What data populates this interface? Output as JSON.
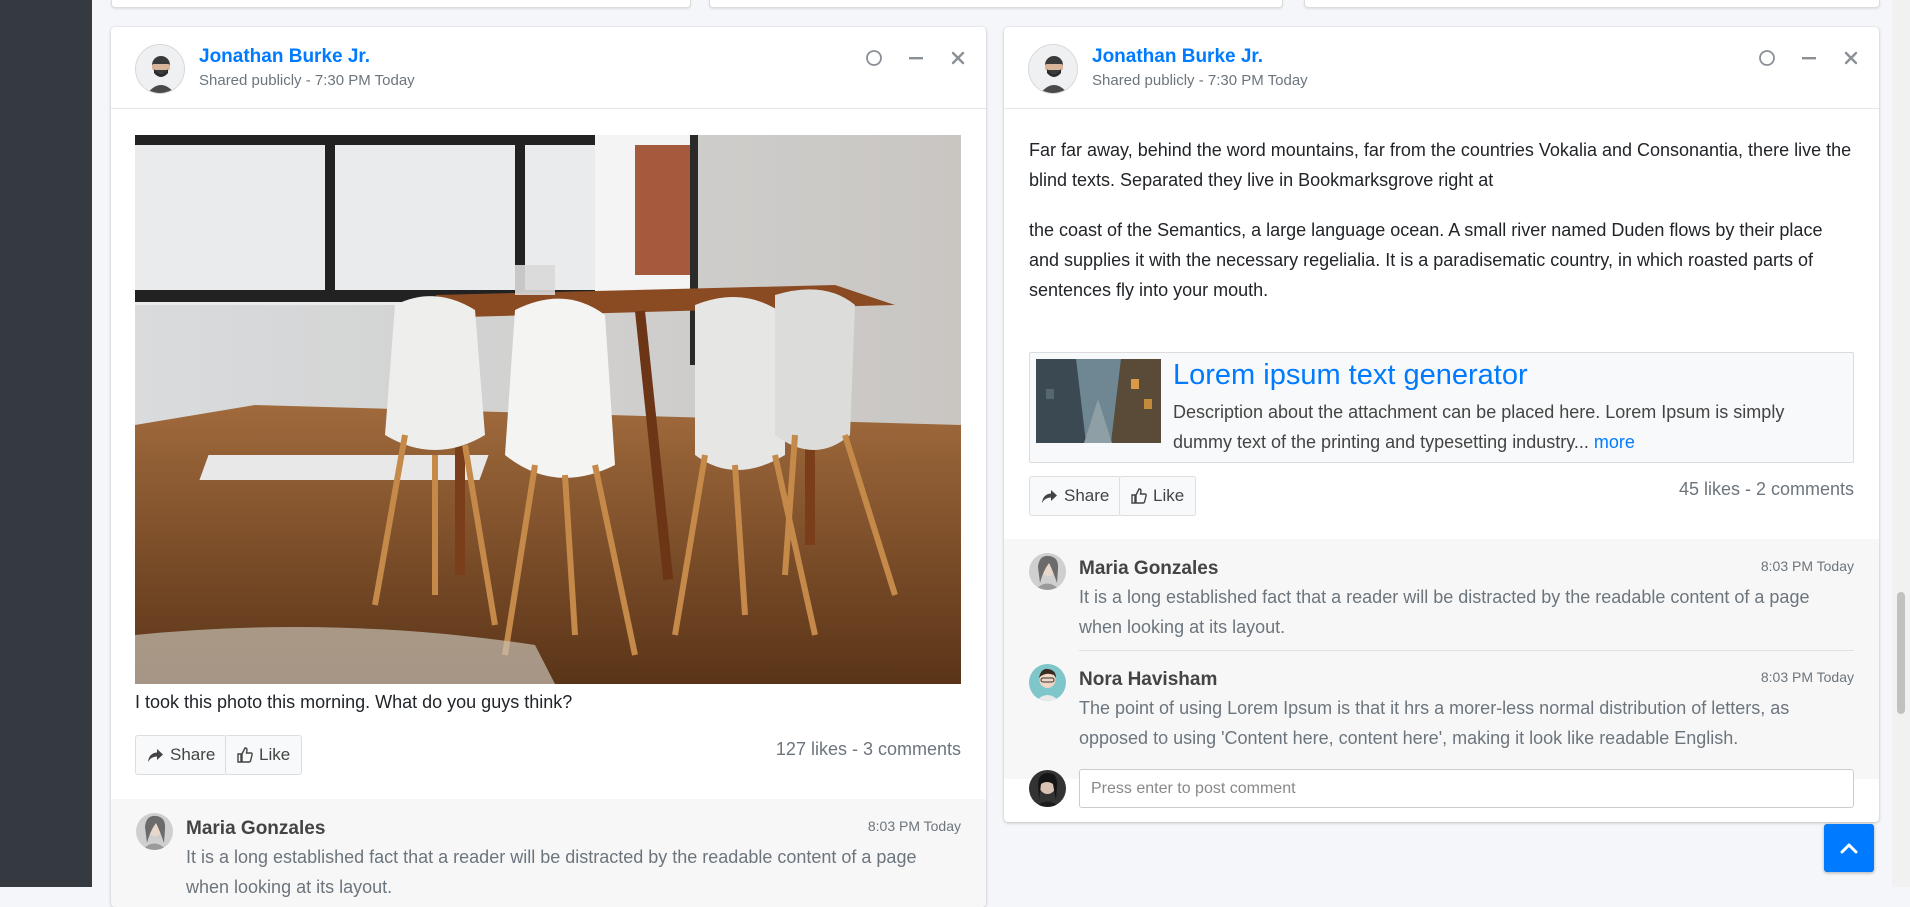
{
  "left_post": {
    "user_name": "Jonathan Burke Jr.",
    "user_desc": "Shared publicly - 7:30 PM Today",
    "caption": "I took this photo this morning. What do you guys think?",
    "share_label": "Share",
    "like_label": "Like",
    "stats": "127 likes - 3 comments",
    "comments": [
      {
        "name": "Maria Gonzales",
        "time": "8:03 PM Today",
        "text": "It is a long established fact that a reader will be distracted by the readable content of a page when looking at its layout."
      }
    ]
  },
  "right_post": {
    "user_name": "Jonathan Burke Jr.",
    "user_desc": "Shared publicly - 7:30 PM Today",
    "paragraph_1": "Far far away, behind the word mountains, far from the countries Vokalia and Consonantia, there live the blind texts. Separated they live in Bookmarksgrove right at",
    "paragraph_2": "the coast of the Semantics, a large language ocean. A small river named Duden flows by their place and supplies it with the necessary regelialia. It is a paradisematic country, in which roasted parts of sentences fly into your mouth.",
    "attachment": {
      "title": "Lorem ipsum text generator",
      "description": "Description about the attachment can be placed here. Lorem Ipsum is simply dummy text of the printing and typesetting industry...",
      "more": "more"
    },
    "share_label": "Share",
    "like_label": "Like",
    "stats": "45 likes - 2 comments",
    "comments": [
      {
        "name": "Maria Gonzales",
        "time": "8:03 PM Today",
        "text": "It is a long established fact that a reader will be distracted by the readable content of a page when looking at its layout."
      },
      {
        "name": "Nora Havisham",
        "time": "8:03 PM Today",
        "text": "The point of using Lorem Ipsum is that it hrs a morer-less normal distribution of letters, as opposed to using 'Content here, content here', making it look like readable English."
      }
    ],
    "comment_placeholder": "Press enter to post comment"
  },
  "icons": {
    "collapse": "circle-icon",
    "minimize": "minus-icon",
    "close": "times-icon",
    "share": "share-icon",
    "like": "thumbs-up-icon",
    "back_to_top": "chevron-up-icon"
  },
  "colors": {
    "accent": "#007bff",
    "sidebar": "#343a40",
    "background": "#f4f6f9"
  }
}
